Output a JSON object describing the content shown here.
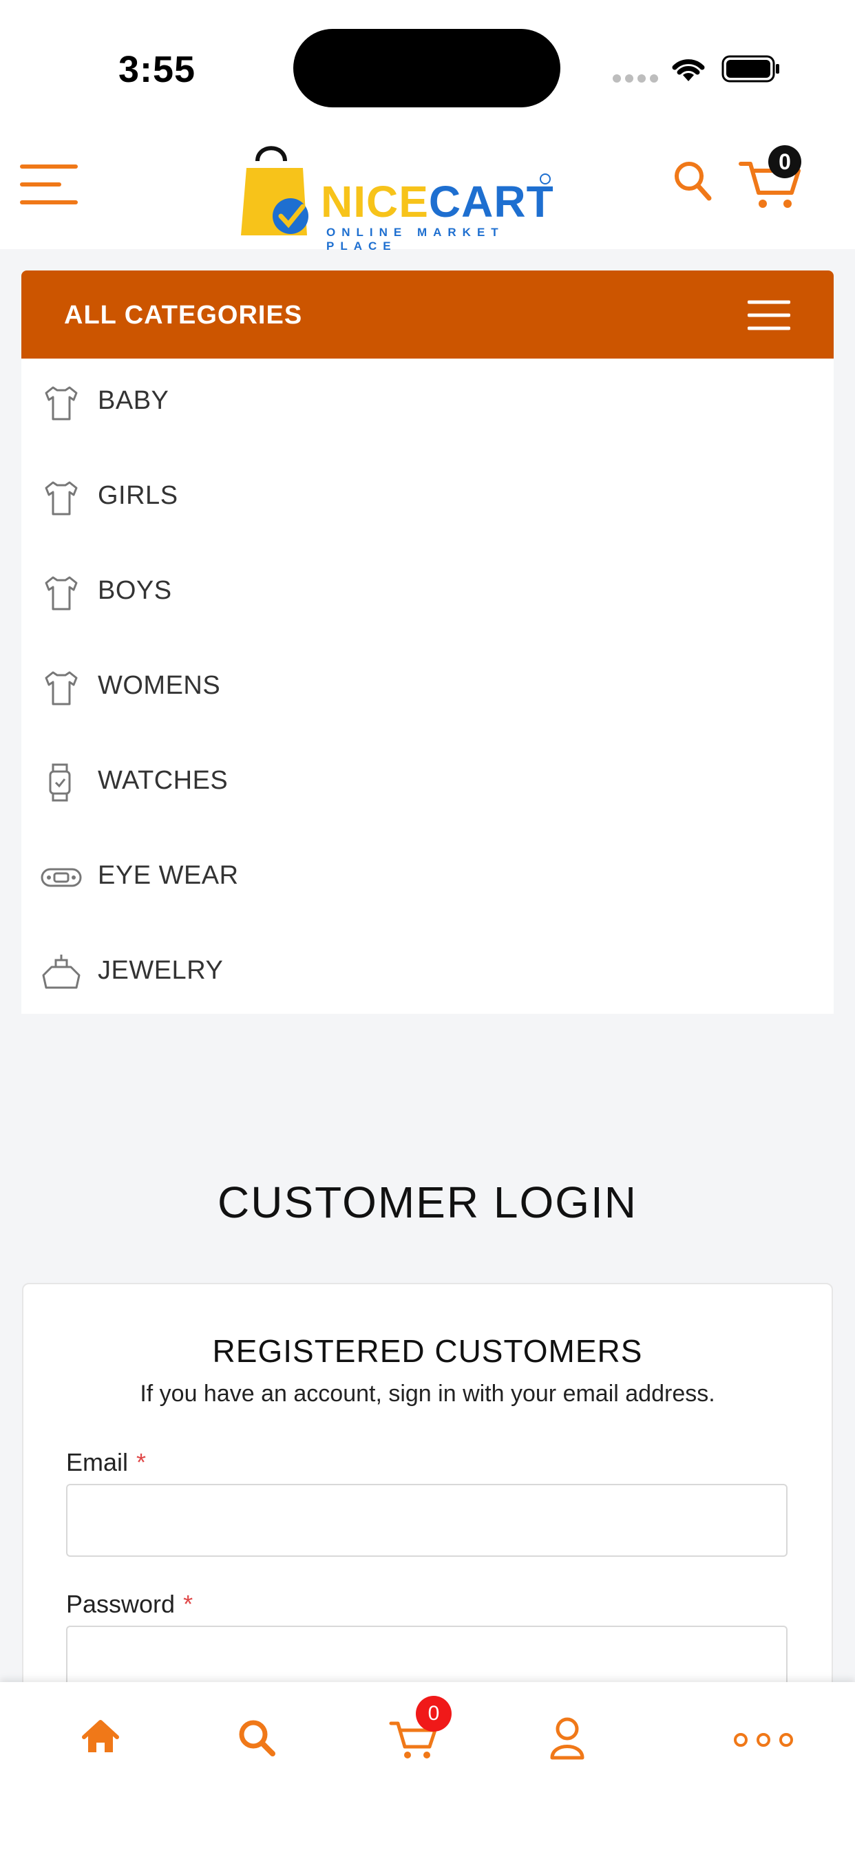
{
  "status_bar": {
    "time": "3:55"
  },
  "header": {
    "logo": {
      "word_nice": "NICE",
      "word_cart": "CART",
      "tagline": "ONLINE MARKET PLACE"
    },
    "cart_count": "0"
  },
  "categories": {
    "title": "ALL CATEGORIES",
    "items": [
      {
        "label": "BABY",
        "icon": "tshirt-icon"
      },
      {
        "label": "GIRLS",
        "icon": "tshirt-icon"
      },
      {
        "label": "BOYS",
        "icon": "tshirt-icon"
      },
      {
        "label": "WOMENS",
        "icon": "tshirt-icon"
      },
      {
        "label": "WATCHES",
        "icon": "watch-icon"
      },
      {
        "label": "EYE WEAR",
        "icon": "eyewear-icon"
      },
      {
        "label": "JEWELRY",
        "icon": "jewelry-icon"
      }
    ]
  },
  "login": {
    "title": "CUSTOMER LOGIN",
    "section_title": "REGISTERED CUSTOMERS",
    "section_subtitle": "If you have an account, sign in with your email address.",
    "email_label": "Email",
    "password_label": "Password",
    "required_mark": "*",
    "email_value": "",
    "password_value": ""
  },
  "bottom_nav": {
    "items": [
      "home-icon",
      "search-icon",
      "cart-icon",
      "account-icon",
      "more-icon"
    ],
    "cart_count": "0"
  },
  "colors": {
    "accent": "#cc5500",
    "icon_orange": "#f07818",
    "logo_yellow": "#f7c31a",
    "logo_blue": "#1e6fd0",
    "badge_red": "#f01919"
  }
}
